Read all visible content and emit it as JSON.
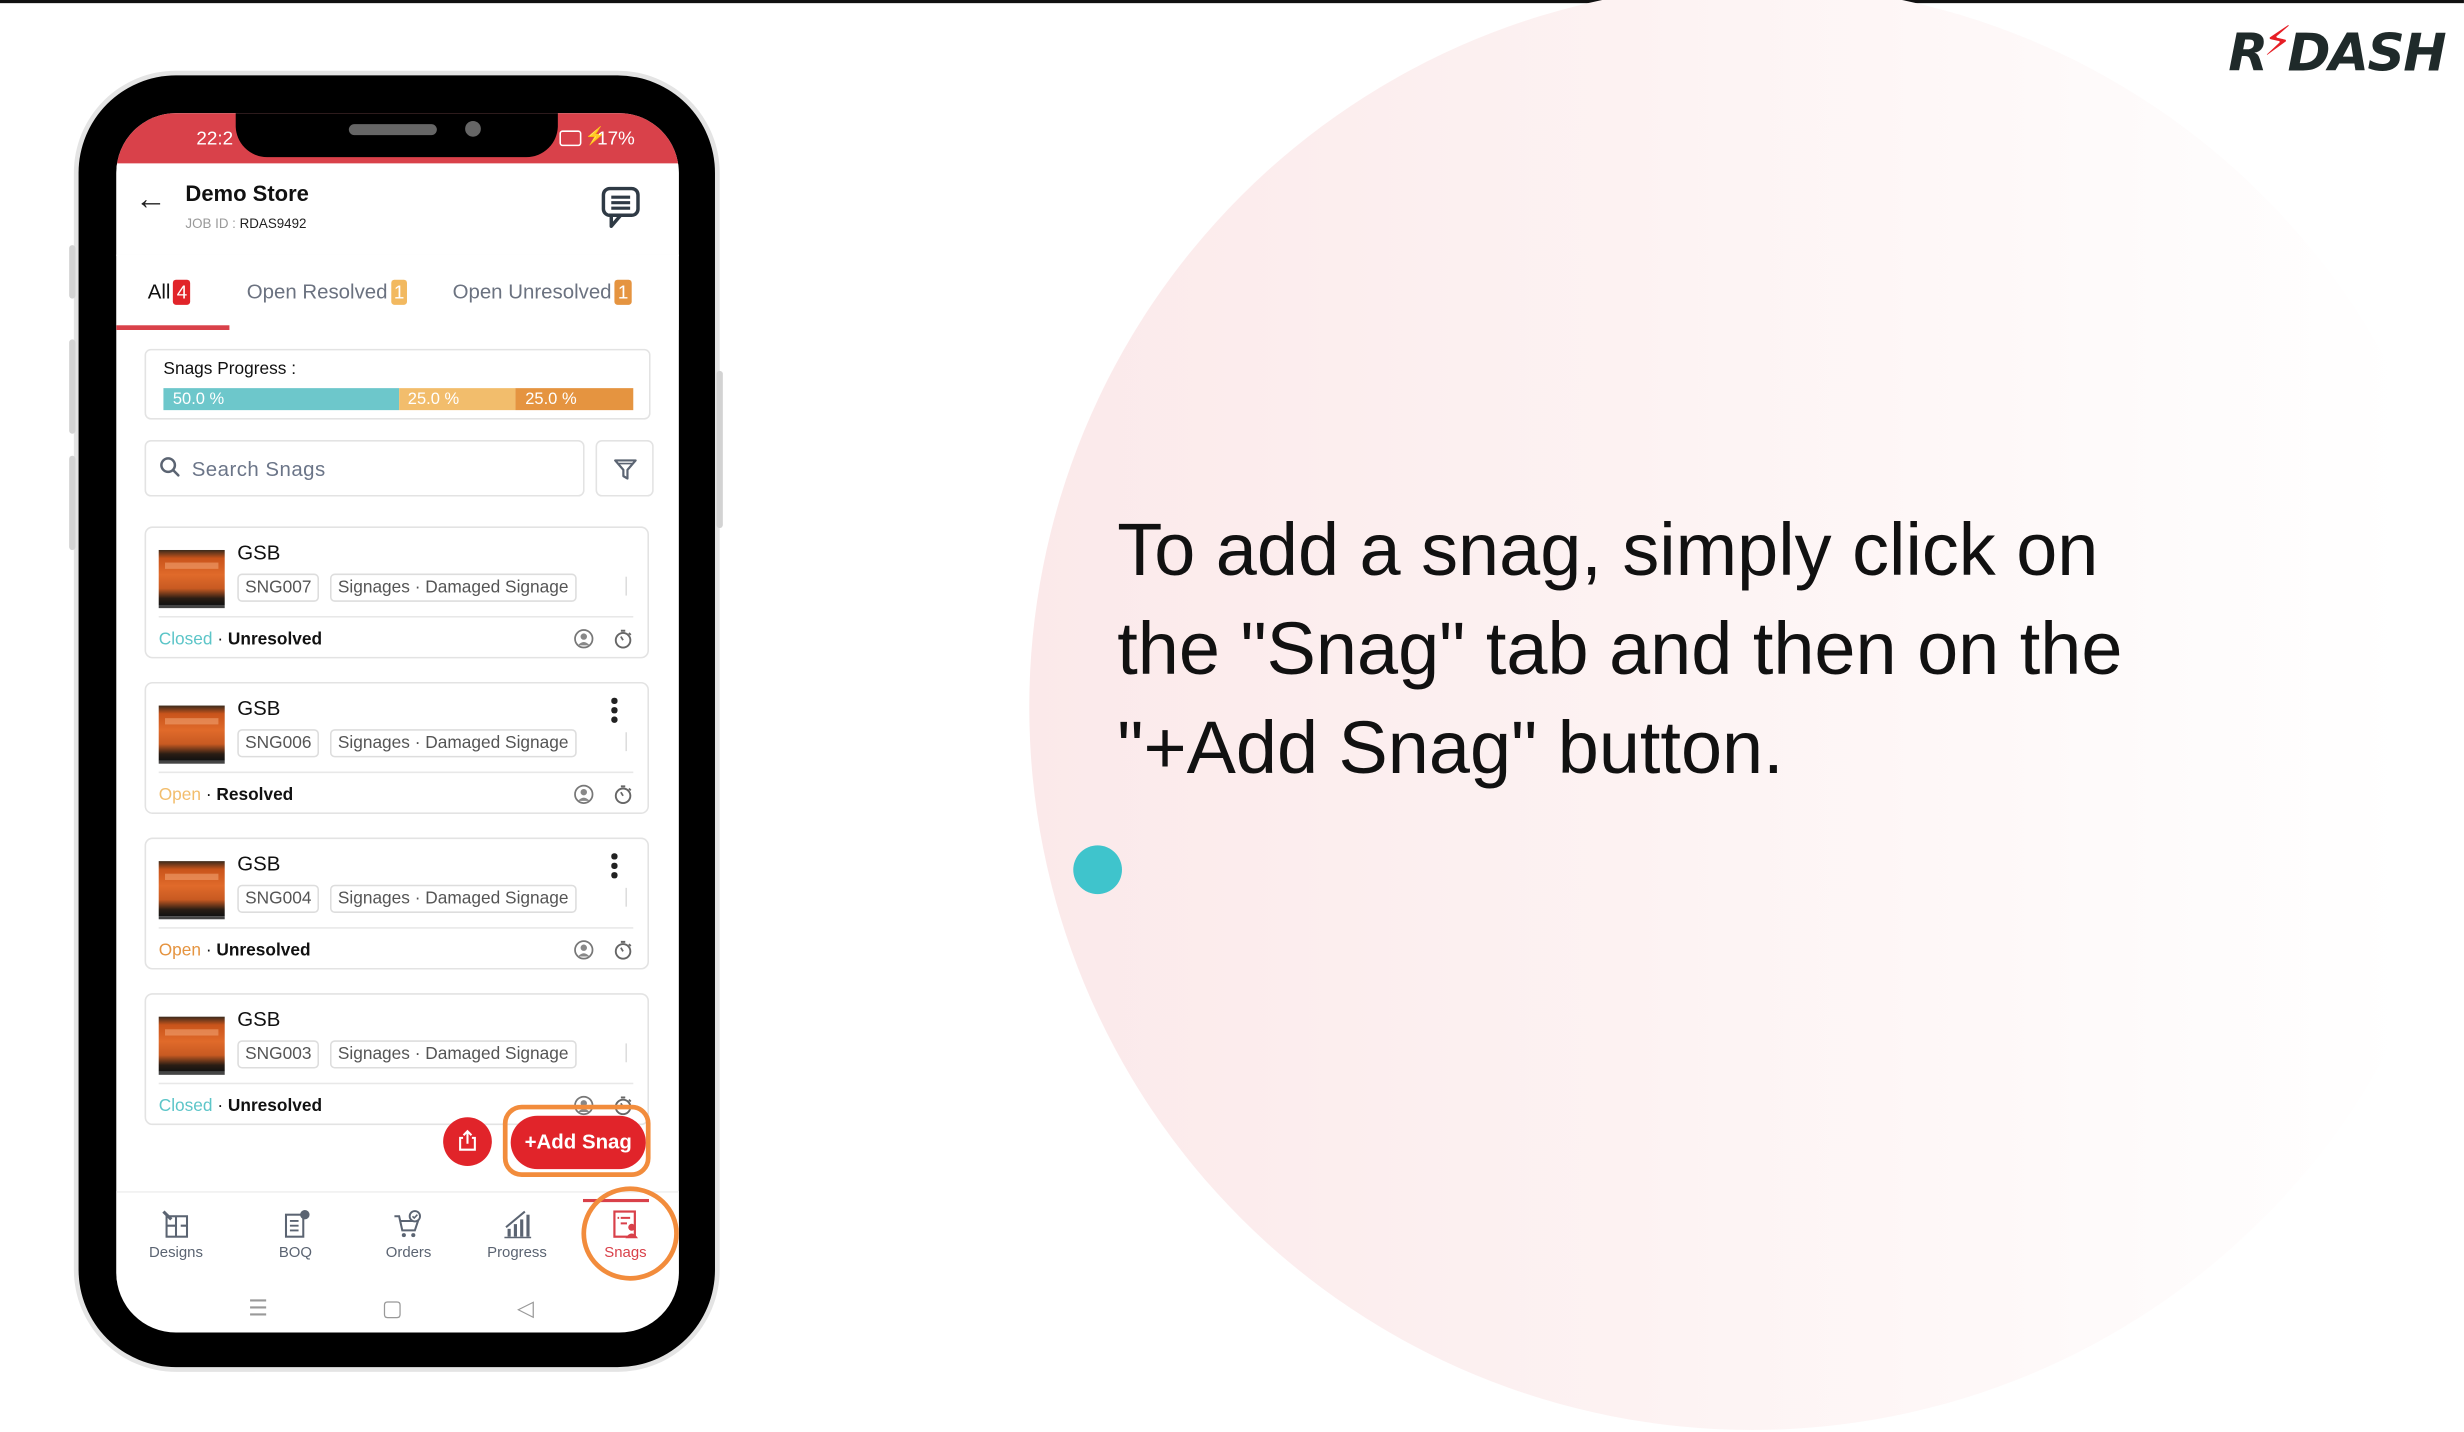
{
  "brand": {
    "logo_left": "R",
    "logo_bolt": "⚡",
    "logo_right": "DASH",
    "accent": "#e61e25"
  },
  "instruction": {
    "text": "To add a snag, simply click on the \"Snag\" tab and then on the \"+Add Snag\" button."
  },
  "phone": {
    "status_bar": {
      "time": "22:2",
      "battery": "17%",
      "charging_icon": "bolt-icon"
    },
    "header": {
      "title": "Demo Store",
      "job_id_label": "JOB ID :",
      "job_id_value": "RDAS9492",
      "back_icon": "arrow-left-icon",
      "chat_icon": "chat-bubble-icon"
    },
    "tabs": [
      {
        "label": "All",
        "count": "4",
        "color": "#e1242a",
        "active": true
      },
      {
        "label": "Open Resolved",
        "count": "1",
        "color": "#f2b960",
        "active": false
      },
      {
        "label": "Open Unresolved",
        "count": "1",
        "color": "#e59440",
        "active": false
      }
    ],
    "progress": {
      "label": "Snags Progress :",
      "segments": [
        {
          "label": "50.0 %",
          "value": 50.0,
          "color": "#6dc7cb"
        },
        {
          "label": "25.0 %",
          "value": 25.0,
          "color": "#f2bd6c"
        },
        {
          "label": "25.0 %",
          "value": 25.0,
          "color": "#e59440"
        }
      ]
    },
    "search": {
      "placeholder": "Search Snags",
      "filter_icon": "filter-icon"
    },
    "snags": [
      {
        "title": "GSB",
        "id": "SNG007",
        "category": "Signages · Damaged Signage",
        "state": "Closed",
        "state_color": "#5cc5c8",
        "resolution": "Unresolved",
        "menu": false
      },
      {
        "title": "GSB",
        "id": "SNG006",
        "category": "Signages · Damaged Signage",
        "state": "Open",
        "state_color": "#f2bd6c",
        "resolution": "Resolved",
        "menu": true
      },
      {
        "title": "GSB",
        "id": "SNG004",
        "category": "Signages · Damaged Signage",
        "state": "Open",
        "state_color": "#e59440",
        "resolution": "Unresolved",
        "menu": true
      },
      {
        "title": "GSB",
        "id": "SNG003",
        "category": "Signages · Damaged Signage",
        "state": "Closed",
        "state_color": "#5cc5c8",
        "resolution": "Unresolved",
        "menu": false
      }
    ],
    "separator": " · ",
    "add_button": "+Add Snag",
    "bottom_nav": [
      {
        "label": "Designs",
        "icon": "blueprint-icon",
        "active": false
      },
      {
        "label": "BOQ",
        "icon": "bill-icon",
        "active": false
      },
      {
        "label": "Orders",
        "icon": "cart-icon",
        "active": false
      },
      {
        "label": "Progress",
        "icon": "bar-chart-icon",
        "active": false
      },
      {
        "label": "Snags",
        "icon": "checklist-icon",
        "active": true
      }
    ],
    "system_nav": {
      "menu": "☰",
      "home": "▢",
      "back": "◁"
    }
  },
  "highlight_color": "#f28c3c",
  "pointer_dot_color": "#3fc4cc"
}
